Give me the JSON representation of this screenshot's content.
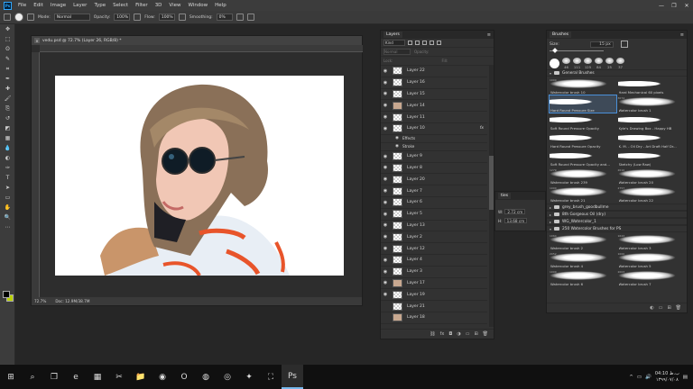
{
  "menubar": {
    "app_icon": "Ps",
    "items": [
      "File",
      "Edit",
      "Image",
      "Layer",
      "Type",
      "Select",
      "Filter",
      "3D",
      "View",
      "Window",
      "Help"
    ],
    "window_controls": [
      "—",
      "❐",
      "✕"
    ]
  },
  "options": {
    "mode_label": "Mode:",
    "mode_value": "Normal",
    "opacity_label": "Opacity:",
    "opacity_value": "100%",
    "flow_label": "Flow:",
    "flow_value": "100%",
    "smoothing_label": "Smoothing:",
    "smoothing_value": "0%"
  },
  "toolbar": {
    "icons": [
      "move-icon",
      "marquee-icon",
      "lasso-icon",
      "quick-select-icon",
      "crop-icon",
      "eyedropper-icon",
      "healing-icon",
      "brush-icon",
      "stamp-icon",
      "history-brush-icon",
      "eraser-icon",
      "gradient-icon",
      "blur-icon",
      "dodge-icon",
      "pen-icon",
      "type-icon",
      "path-select-icon",
      "shape-icon",
      "hand-icon",
      "zoom-icon",
      "more-icon"
    ],
    "glyphs": [
      "✥",
      "⬚",
      "ʘ",
      "✎",
      "⌗",
      "✒",
      "✚",
      "🖌",
      "⎘",
      "↺",
      "◩",
      "▦",
      "💧",
      "◐",
      "✑",
      "T",
      "➤",
      "▭",
      "✋",
      "🔍",
      "⋯"
    ],
    "colors": {
      "foreground": "#000000",
      "background": "#b8d000"
    }
  },
  "document": {
    "tab_title": "vedu.psd @ 72.7% (Layer 26, RGB/8) *",
    "zoom": "72.7%",
    "doc_size": "Doc: 12.9M/38.7M"
  },
  "layers_panel": {
    "title": "Layers",
    "kind_label": "Kind",
    "normal_label": "Normal",
    "opacity_label": "Opacity:",
    "lock_label": "Lock:",
    "fill_label": "Fill:",
    "effects_label": "Effects",
    "stroke_label": "Stroke",
    "layers": [
      {
        "name": "Layer 22",
        "visible": true
      },
      {
        "name": "Layer 16",
        "visible": true
      },
      {
        "name": "Layer 15",
        "visible": true
      },
      {
        "name": "Layer 14",
        "visible": true
      },
      {
        "name": "Layer 11",
        "visible": true
      },
      {
        "name": "Layer 10",
        "visible": true,
        "fx": "fx"
      },
      {
        "name": "Layer 9",
        "visible": true
      },
      {
        "name": "Layer 8",
        "visible": true
      },
      {
        "name": "Layer 20",
        "visible": true
      },
      {
        "name": "Layer 7",
        "visible": true
      },
      {
        "name": "Layer 6",
        "visible": true
      },
      {
        "name": "Layer 5",
        "visible": true
      },
      {
        "name": "Layer 13",
        "visible": true
      },
      {
        "name": "Layer 2",
        "visible": true
      },
      {
        "name": "Layer 12",
        "visible": true
      },
      {
        "name": "Layer 4",
        "visible": true
      },
      {
        "name": "Layer 3",
        "visible": true
      },
      {
        "name": "Layer 17",
        "visible": true
      },
      {
        "name": "Layer 19",
        "visible": true
      },
      {
        "name": "Layer 21",
        "visible": false
      },
      {
        "name": "Layer 18",
        "visible": false
      }
    ],
    "footer_icons": [
      "link-icon",
      "fx-icon",
      "mask-icon",
      "adjustment-icon",
      "group-icon",
      "new-layer-icon",
      "delete-icon"
    ],
    "footer_glyphs": [
      "⛓",
      "fx",
      "◘",
      "◑",
      "▭",
      "⊞",
      "🗑"
    ]
  },
  "properties": {
    "title": "ties",
    "w_label": "W:",
    "w_value": "2.72 cm",
    "h_label": "H:",
    "h_value": "13.68 cm"
  },
  "brushes_panel": {
    "title": "Brushes",
    "size_label": "Size:",
    "size_value": "15 px",
    "recent_sizes": [
      "46",
      "111",
      "125",
      "84",
      "25",
      "37"
    ],
    "groups": [
      {
        "name": "General Brushes",
        "open": true
      },
      {
        "name": "grey_brush_goodbullme",
        "open": false
      },
      {
        "name": "8th Gorgeous Oil (dry)",
        "open": false
      },
      {
        "name": "WG_Watercolor_1",
        "open": false
      },
      {
        "name": "250 Watercolor Brushes for PS",
        "open": true
      }
    ],
    "general_brushes": [
      {
        "num": "1000",
        "name": "Watercolor brush 10"
      },
      {
        "num": "",
        "name": "Hard Mechanical 60 pixels"
      },
      {
        "num": "",
        "name": "Hard Round Pressure Size",
        "selected": true
      },
      {
        "num": "3074",
        "name": "Watercolor brush 1"
      },
      {
        "num": "",
        "name": "Soft Round Pressure Opacity"
      },
      {
        "num": "",
        "name": "Kyle's Drawing Box - Happy HB"
      },
      {
        "num": "",
        "name": "Hard Round Pressure Opacity"
      },
      {
        "num": "",
        "name": "K. M. - Oil Dry - Art Draft Half Dr..."
      },
      {
        "num": "",
        "name": "Soft Round Pressure Opacity and..."
      },
      {
        "num": "",
        "name": "Sketchy (Low Raw)"
      },
      {
        "num": "1279",
        "name": "Watercolor brush 239"
      },
      {
        "num": "2010",
        "name": "Watercolor brush 20"
      },
      {
        "num": "1000",
        "name": "Watercolor brush 21"
      },
      {
        "num": "2757",
        "name": "Watercolor brush 22"
      }
    ],
    "watercolor_brushes": [
      {
        "num": "1064",
        "name": "Watercolor brush 2"
      },
      {
        "num": "1643",
        "name": "Watercolor brush 3"
      },
      {
        "num": "2052",
        "name": "Watercolor brush 4"
      },
      {
        "num": "1000",
        "name": "Watercolor brush 5"
      },
      {
        "num": "1000",
        "name": "Watercolor brush 6"
      },
      {
        "num": "2003",
        "name": "Watercolor brush 7"
      }
    ]
  },
  "taskbar": {
    "icons": [
      "windows-icon",
      "search-icon",
      "task-view-icon",
      "edge-icon",
      "calculator-icon",
      "snipping-icon",
      "explorer-icon",
      "chrome-icon",
      "opera-icon",
      "firefox-icon",
      "media-icon",
      "app-icon",
      "store-icon",
      "photoshop-icon"
    ],
    "glyphs": [
      "⊞",
      "⌕",
      "❐",
      "e",
      "▦",
      "✂",
      "📁",
      "◉",
      "O",
      "◍",
      "◎",
      "✦",
      "⛶",
      "Ps"
    ],
    "time": "04:10 ب.ظ",
    "date": "۱۳۹۹/۰۷/۰۸"
  }
}
